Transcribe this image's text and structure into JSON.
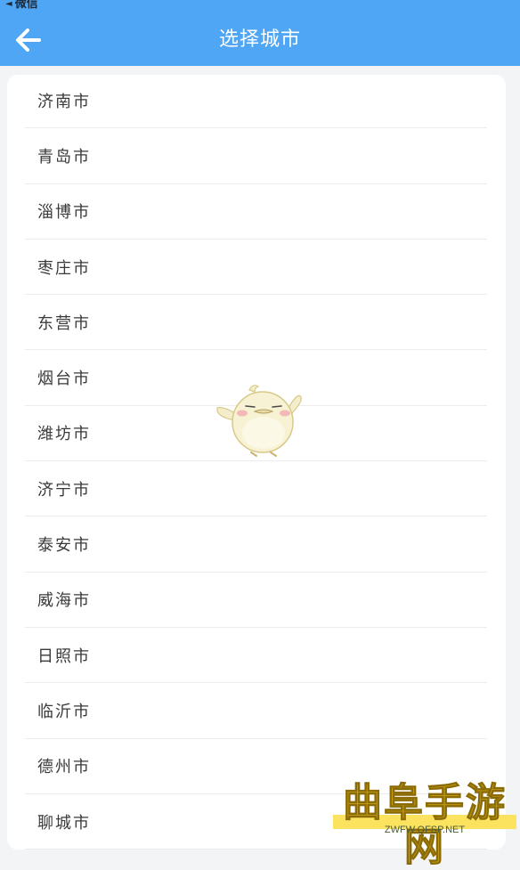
{
  "status_bar": {
    "back_arrow": "◄",
    "back_label": "微信"
  },
  "header": {
    "title": "选择城市",
    "back_icon": "arrow-left-icon"
  },
  "cities": [
    "济南市",
    "青岛市",
    "淄博市",
    "枣庄市",
    "东营市",
    "烟台市",
    "潍坊市",
    "济宁市",
    "泰安市",
    "威海市",
    "日照市",
    "临沂市",
    "德州市",
    "聊城市"
  ],
  "watermark": {
    "title": "曲阜手游网",
    "url": "ZWFW.QFSP.NET"
  },
  "colors": {
    "header_bg": "#4fa6f5",
    "page_bg": "#f3f4f6",
    "card_bg": "#ffffff",
    "text": "#3a3a3a"
  }
}
